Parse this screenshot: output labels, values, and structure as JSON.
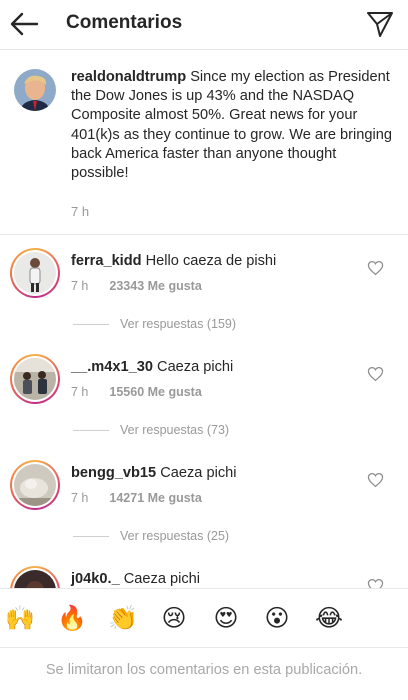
{
  "header": {
    "title": "Comentarios",
    "back_icon": "arrow-left-icon",
    "send_icon": "paper-plane-icon"
  },
  "caption": {
    "username": "realdonaldtrump",
    "text": "Since my election as President the Dow Jones is up 43% and the NASDAQ Composite almost 50%. Great news for your 401(k)s as they continue to grow. We are bringing back America faster than anyone thought possible!",
    "time": "7 h"
  },
  "comments": [
    {
      "username": "ferra_kidd",
      "text": "Hello caeza de pishi",
      "time": "7 h",
      "likes": "23343 Me gusta",
      "replies": "Ver respuestas (159)"
    },
    {
      "username": "__.m4x1_30",
      "text": "Caeza pichi",
      "time": "7 h",
      "likes": "15560 Me gusta",
      "replies": "Ver respuestas (73)"
    },
    {
      "username": "bengg_vb15",
      "text": "Caeza pichi",
      "time": "7 h",
      "likes": "14271 Me gusta",
      "replies": "Ver respuestas (25)"
    },
    {
      "username": "j04k0._",
      "text": "Caeza pichi"
    }
  ],
  "emoji_bar": [
    {
      "icon": "raising-hands-emoji",
      "glyph": "🙌"
    },
    {
      "icon": "fire-emoji",
      "glyph": "🔥"
    },
    {
      "icon": "clapping-hands-emoji",
      "glyph": "👏"
    },
    {
      "icon": "crying-face-emoji",
      "glyph": "😢"
    },
    {
      "icon": "heart-eyes-emoji",
      "glyph": "😍"
    },
    {
      "icon": "surprised-face-emoji",
      "glyph": "😮"
    },
    {
      "icon": "tears-of-joy-emoji",
      "glyph": "😂"
    }
  ],
  "footer": {
    "limited_text": "Se limitaron los comentarios en esta publicación."
  },
  "colors": {
    "text": "#262626",
    "secondary": "#999999",
    "ring_start": "#f7b24a",
    "ring_end": "#c02e8c"
  }
}
